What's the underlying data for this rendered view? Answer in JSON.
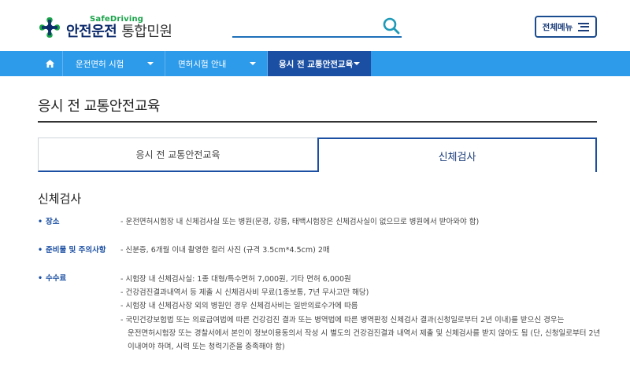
{
  "header": {
    "logo_small": "SafeDriving",
    "logo_brand": "안전운전",
    "logo_sub": "통합민원",
    "menu_label": "전체메뉴"
  },
  "nav": {
    "items": [
      {
        "label": "운전면허 시험"
      },
      {
        "label": "면허시험 안내"
      },
      {
        "label": "응시 전 교통안전교육"
      }
    ]
  },
  "page": {
    "title": "응시 전 교통안전교육"
  },
  "tabs": [
    {
      "label": "응시 전 교통안전교육"
    },
    {
      "label": "신체검사"
    }
  ],
  "section": {
    "title": "신체검사",
    "rows": [
      {
        "label": "장소",
        "lines": [
          "- 운전면허시험장 내 신체검사실 또는 병원(문경, 강릉, 태백시험장은 신체검사실이 없으므로 병원에서 받아와야 함)"
        ]
      },
      {
        "label": "준비물 및 주의사항",
        "lines": [
          "- 신분증, 6개월 이내 촬영한 컬러 사진 (규격 3.5cm*4.5cm) 2매"
        ]
      },
      {
        "label": "수수료",
        "lines": [
          "- 시험장 내 신체검사실: 1종 대형/특수면허 7,000원, 기타 면허 6,000원",
          "- 건강검진결과내역서 등 제출 시 신체검사비 무료(1종보통, 7년 무사고만 해당)",
          "- 시험장 내 신체검사장 외의 병원인 경우 신체검사비는 일반의료수가에 따름",
          "- 국민건강보험법 또는 의료급여법에 따른 건강검진 결과 또는 병역법에 따른 병역판정 신체검사 결과(신청일로부터 2년 이내)를 받으신 경우는",
          "운전면허시험장 또는 경찰서에서 본인이 정보이용동의서 작성 시 별도의 건강검진결과 내역서 제출 및 신체검사를 받지 않아도 됨 (단, 신청일로부터 2년",
          "이내여야 하며, 시력 또는 청력기준을 충족해야 함)"
        ]
      }
    ]
  },
  "colors": {
    "nav_bg": "#2d9bea",
    "nav_active": "#1b4fa3",
    "brand_navy": "#0b2a6b",
    "brand_green": "#1aa34a"
  },
  "icons": {
    "home": "home-icon",
    "search": "search-icon",
    "menu": "hamburger-icon",
    "logo": "logo-cross-icon"
  }
}
